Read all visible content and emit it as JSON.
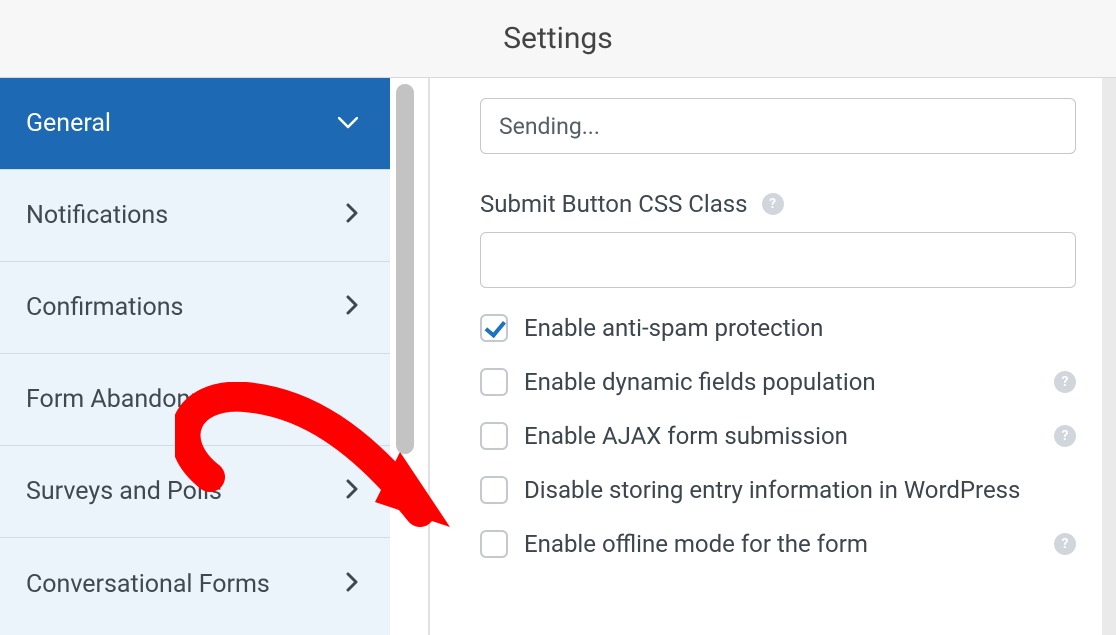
{
  "header": {
    "title": "Settings"
  },
  "sidebar": {
    "items": [
      {
        "label": "General"
      },
      {
        "label": "Notifications"
      },
      {
        "label": "Confirmations"
      },
      {
        "label": "Form Abandonment"
      },
      {
        "label": "Surveys and Polls"
      },
      {
        "label": "Conversational Forms"
      }
    ]
  },
  "main": {
    "sending_value": "Sending...",
    "submit_css_label": "Submit Button CSS Class",
    "submit_css_value": "",
    "checkboxes": [
      {
        "label": "Enable anti-spam protection",
        "help": false
      },
      {
        "label": "Enable dynamic fields population",
        "help": true
      },
      {
        "label": "Enable AJAX form submission",
        "help": true
      },
      {
        "label": "Disable storing entry information in WordPress",
        "help": false
      },
      {
        "label": "Enable offline mode for the form",
        "help": true
      }
    ]
  }
}
